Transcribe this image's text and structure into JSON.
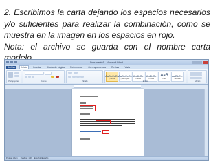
{
  "instructions": {
    "paragraph_1": "2. Escribimos la carta dejando los espacios necesarios y/o suficientes para realizar la combinación, como se muestra en la imagen en los espacios en rojo.",
    "paragraph_2": "Nota: el archivo se guarda con el nombre carta modelo."
  },
  "word_window": {
    "title": "Documento1 - Microsoft Word",
    "tabs": [
      "Archivo",
      "Inicio",
      "Insertar",
      "Diseño de página",
      "Referencias",
      "Correspondencia",
      "Revisar",
      "Vista"
    ],
    "active_tab_index": 1,
    "ribbon_groups": [
      "Portapapeles",
      "Fuente",
      "Párrafo",
      "Estilos",
      "Edición"
    ],
    "styles": [
      {
        "sample": "AaBbCcDc",
        "name": "¶ Normal",
        "large": false,
        "selected": true
      },
      {
        "sample": "AaBbCcDc",
        "name": "¶ Sin espa...",
        "large": false,
        "selected": false
      },
      {
        "sample": "AaBbCc",
        "name": "Título 1",
        "large": false,
        "selected": false
      },
      {
        "sample": "AaBbCc",
        "name": "Título 2",
        "large": false,
        "selected": false
      },
      {
        "sample": "AaB",
        "name": "Título",
        "large": true,
        "selected": false
      },
      {
        "sample": "AaBbCc.",
        "name": "Subtítulo",
        "large": false,
        "selected": false
      }
    ],
    "status_items": [
      "Página: 1 de 1",
      "Palabras: 188",
      "Español (España)"
    ]
  }
}
